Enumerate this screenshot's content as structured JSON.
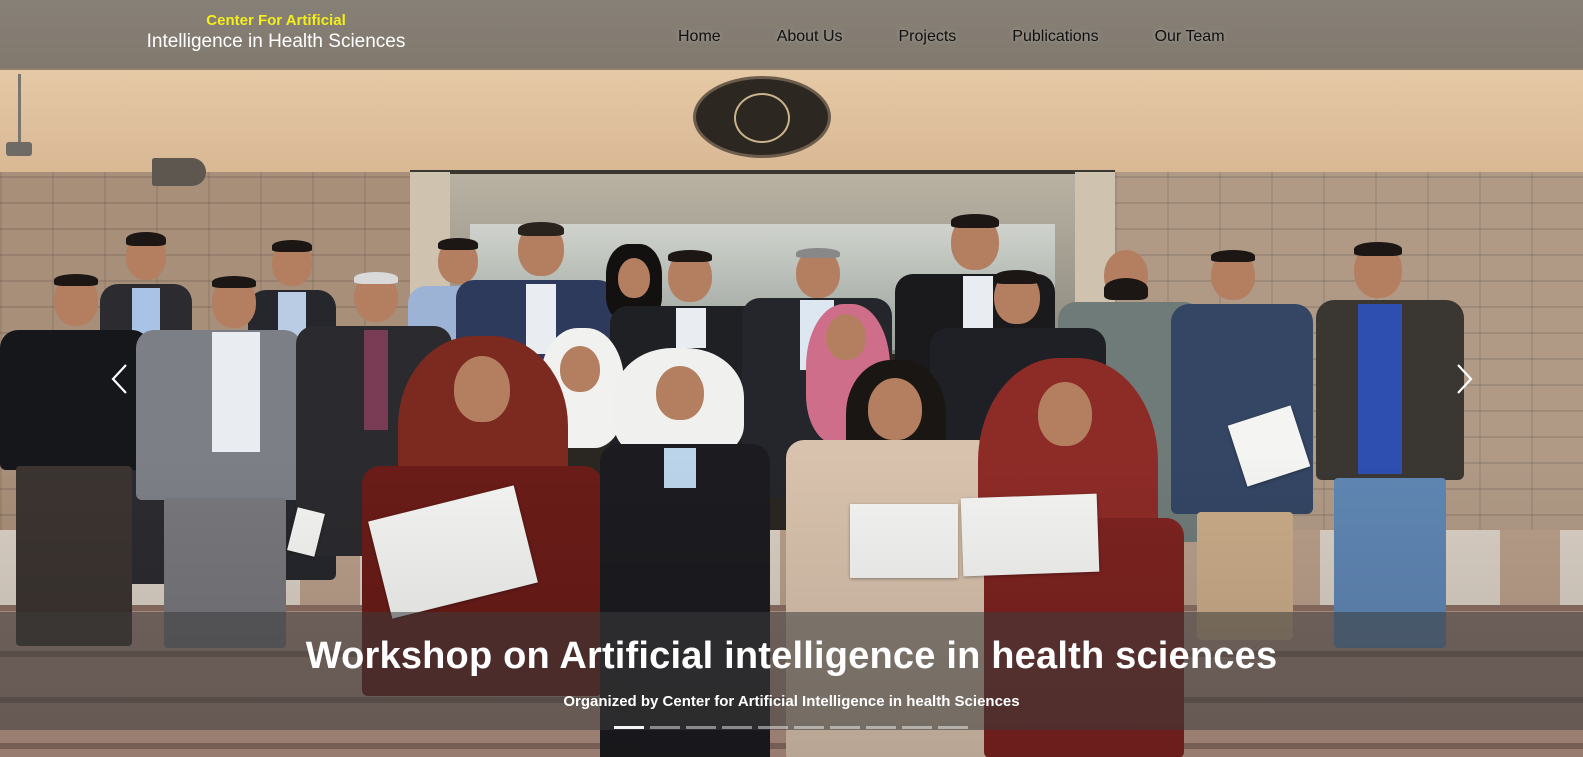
{
  "brand": {
    "line1": "Center For Artificial",
    "line2": "Intelligence in Health Sciences"
  },
  "nav": {
    "items": [
      {
        "label": "Home"
      },
      {
        "label": "About Us"
      },
      {
        "label": "Projects"
      },
      {
        "label": "Publications"
      },
      {
        "label": "Our Team"
      }
    ]
  },
  "carousel": {
    "title": "Workshop on Artificial intelligence in health sciences",
    "subtitle": "Organized by Center for Artificial Intelligence in health Sciences",
    "prev_icon": "chevron-left-icon",
    "next_icon": "chevron-right-icon",
    "slide_count": 10,
    "active_index": 0
  },
  "colors": {
    "brand_yellow": "#f4ee1c",
    "nav_text": "#111111",
    "caption_text": "#ffffff"
  }
}
